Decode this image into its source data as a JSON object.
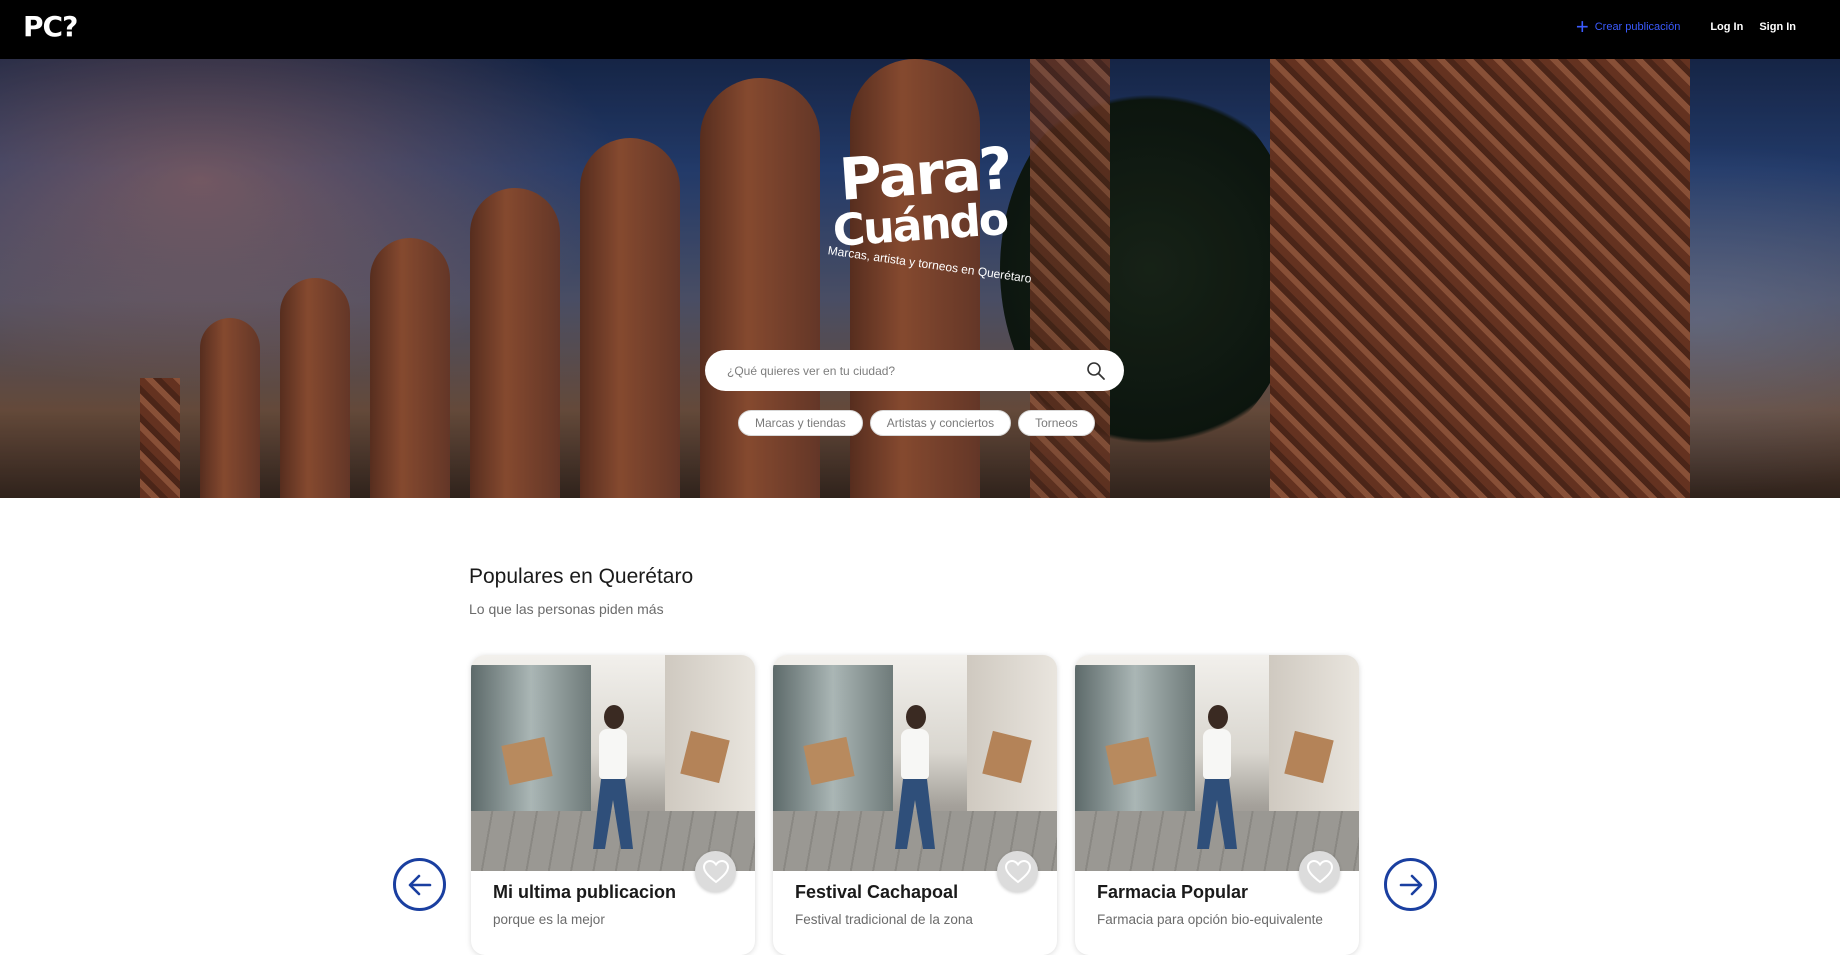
{
  "header": {
    "logo_text": "PC?",
    "create_label": "Crear publicación",
    "login_label": "Log In",
    "signin_label": "Sign In"
  },
  "hero": {
    "brand_line1": "Para?",
    "brand_line2": "Cuándo",
    "tagline": "Marcas, artista y torneos en Querétaro",
    "search_placeholder": "¿Qué quieres ver en tu ciudad?",
    "chips": [
      "Marcas y tiendas",
      "Artistas y conciertos",
      "Torneos"
    ]
  },
  "section": {
    "title": "Populares en Querétaro",
    "subtitle": "Lo que las personas piden más",
    "cards": [
      {
        "title": "Mi ultima publicacion",
        "description": "porque es la mejor"
      },
      {
        "title": "Festival Cachapoal",
        "description": "Festival tradicional de la zona"
      },
      {
        "title": "Farmacia Popular",
        "description": "Farmacia para opción bio-equivalente"
      }
    ]
  },
  "colors": {
    "accent": "#1a3fa0",
    "create_link": "#3b5bff",
    "topbar": "#000000"
  },
  "icons": {
    "plus": "plus-icon",
    "search": "search-icon",
    "heart": "heart-icon",
    "prev": "arrow-left-icon",
    "next": "arrow-right-icon"
  }
}
